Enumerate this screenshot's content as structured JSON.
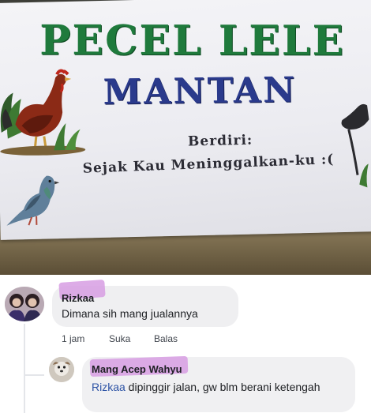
{
  "banner": {
    "title_line1": "PECEL LELE",
    "title_line2": "MANTAN",
    "berdiri_label": "Berdiri:",
    "berdiri_text": "Sejak Kau Meninggalkan-ku :("
  },
  "comment": {
    "author": "Rizkaa",
    "text": "Dimana sih mang jualannya",
    "time": "1 jam",
    "like_label": "Suka",
    "reply_label": "Balas"
  },
  "reply": {
    "author": "Mang Acep Wahyu",
    "mention": "Rizkaa",
    "text": " dipinggir jalan, gw blm berani ketengah"
  },
  "colors": {
    "title_green": "#1f7a3c",
    "title_blue": "#2a3a8c",
    "name_highlight": "#d79ee3",
    "mention_blue": "#2d53a5",
    "bubble_bg": "#efeff1"
  }
}
